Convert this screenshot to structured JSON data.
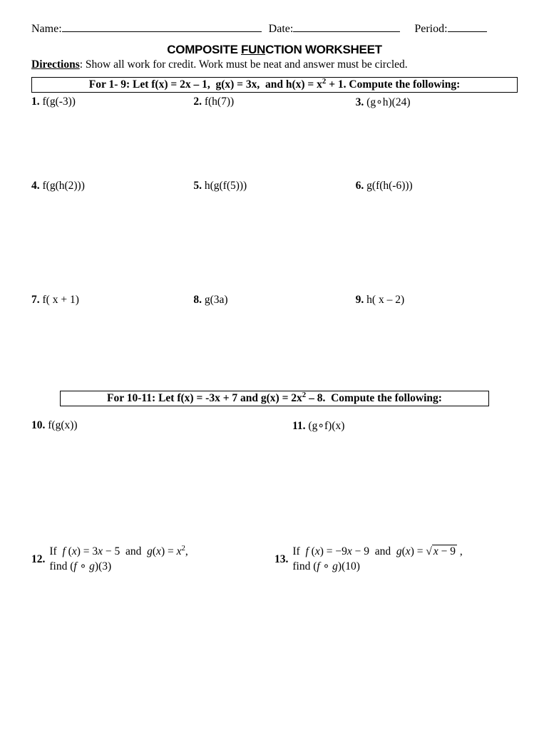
{
  "header": {
    "name_label": "Name:",
    "date_label": "Date:",
    "period_label": "Period:"
  },
  "title": {
    "pre": "COMPOSITE ",
    "fun": "FUN",
    "post": "CTION WORKSHEET"
  },
  "directions": {
    "label": "Directions",
    "text": ": Show all work for credit. Work must be neat and answer must be circled."
  },
  "section1": {
    "header": "For 1- 9: Let f(x) = 2x – 1,  g(x) = 3x,  and h(x) = x² + 1. Compute the following:",
    "q1": {
      "num": "1.",
      "text": "f(g(-3))"
    },
    "q2": {
      "num": "2.",
      "text": "f(h(7))"
    },
    "q3": {
      "num": "3.",
      "text": "(g∘h)(24)"
    },
    "q4": {
      "num": "4.",
      "text": "f(g(h(2)))"
    },
    "q5": {
      "num": "5.",
      "text": "h(g(f(5)))"
    },
    "q6": {
      "num": "6.",
      "text": "g(f(h(-6)))"
    },
    "q7": {
      "num": "7.",
      "text": "f( x + 1)"
    },
    "q8": {
      "num": "8.",
      "text": "g(3a)"
    },
    "q9": {
      "num": "9.",
      "text": "h( x – 2)"
    }
  },
  "section2": {
    "header": "For 10-11: Let f(x) = -3x + 7 and g(x) = 2x² – 8.  Compute the following:",
    "q10": {
      "num": "10.",
      "text": "f(g(x))"
    },
    "q11": {
      "num": "11.",
      "text": "(g∘f)(x)"
    }
  },
  "section3": {
    "q12": {
      "num": "12.",
      "line1": "If  f (x) = 3x − 5  and  g(x) = x²,",
      "line2": "find ( f ∘ g)(3)"
    },
    "q13": {
      "num": "13.",
      "line1_pre": "If  f (x) = −9x − 9  and  g(x) = ",
      "line1_rad": "x − 9",
      "line1_post": " ,",
      "line2": "find ( f ∘ g)(10)"
    }
  }
}
